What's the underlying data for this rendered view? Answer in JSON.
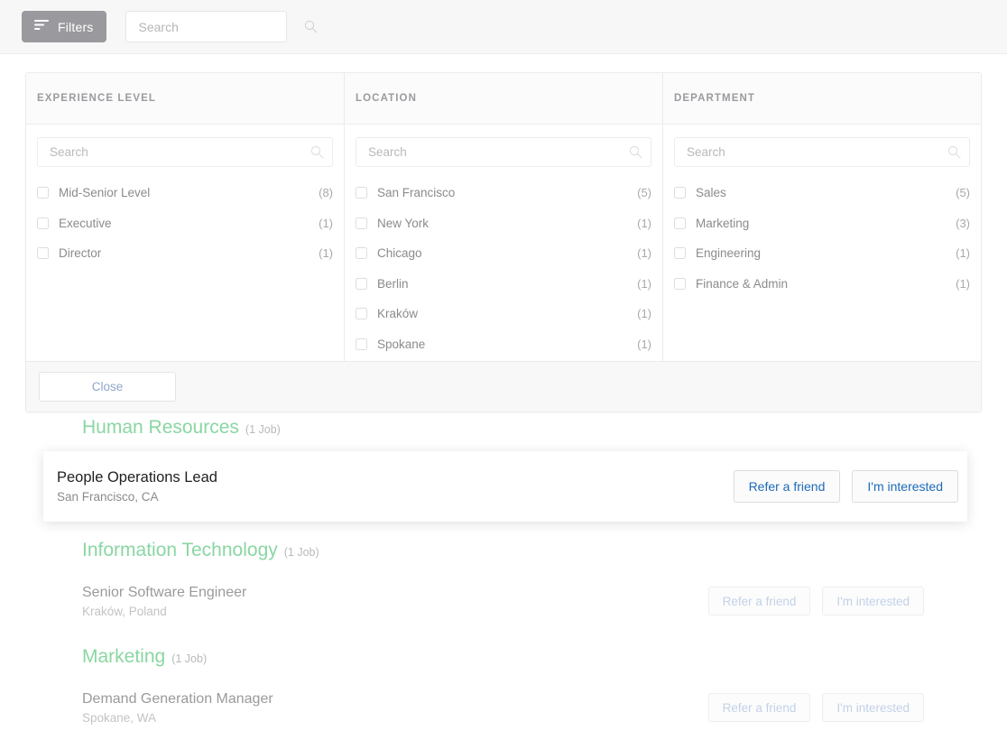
{
  "topbar": {
    "filters_label": "Filters",
    "search_placeholder": "Search",
    "search_value": ""
  },
  "filter_panel": {
    "columns": [
      {
        "header": "EXPERIENCE LEVEL",
        "search_placeholder": "Search",
        "search_value": "",
        "options": [
          {
            "label": "Mid-Senior Level",
            "count": "(8)"
          },
          {
            "label": "Executive",
            "count": "(1)"
          },
          {
            "label": "Director",
            "count": "(1)"
          }
        ]
      },
      {
        "header": "LOCATION",
        "search_placeholder": "Search",
        "search_value": "",
        "options": [
          {
            "label": "San Francisco",
            "count": "(5)"
          },
          {
            "label": "New York",
            "count": "(1)"
          },
          {
            "label": "Chicago",
            "count": "(1)"
          },
          {
            "label": "Berlin",
            "count": "(1)"
          },
          {
            "label": "Kraków",
            "count": "(1)"
          },
          {
            "label": "Spokane",
            "count": "(1)"
          }
        ]
      },
      {
        "header": "DEPARTMENT",
        "search_placeholder": "Search",
        "search_value": "",
        "options": [
          {
            "label": "Sales",
            "count": "(5)"
          },
          {
            "label": "Marketing",
            "count": "(3)"
          },
          {
            "label": "Engineering",
            "count": "(1)"
          },
          {
            "label": "Finance & Admin",
            "count": "(1)"
          }
        ]
      }
    ],
    "close_label": "Close"
  },
  "job_groups": [
    {
      "name": "Human Resources",
      "count": "(1 Job)",
      "highlighted": true,
      "job": {
        "title": "People Operations Lead",
        "location": "San Francisco, CA",
        "refer_label": "Refer a friend",
        "interested_label": "I'm interested"
      }
    },
    {
      "name": "Information Technology",
      "count": "(1 Job)",
      "highlighted": false,
      "job": {
        "title": "Senior Software Engineer",
        "location": "Kraków, Poland",
        "refer_label": "Refer a friend",
        "interested_label": "I'm interested"
      }
    },
    {
      "name": "Marketing",
      "count": "(1 Job)",
      "highlighted": false,
      "job": {
        "title": "Demand Generation Manager",
        "location": "Spokane, WA",
        "refer_label": "Refer a friend",
        "interested_label": "I'm interested"
      }
    }
  ],
  "colors": {
    "filters_button_bg": "#9a9a9e",
    "group_heading": "#8ad6a3",
    "action_link": "#1d6bb8",
    "close_link": "#8fa8c8"
  }
}
